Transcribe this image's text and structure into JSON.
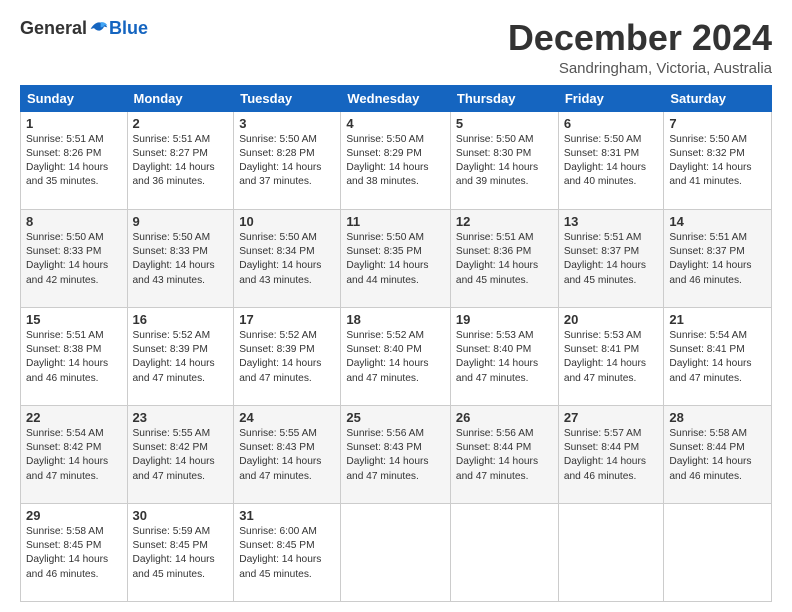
{
  "header": {
    "logo_general": "General",
    "logo_blue": "Blue",
    "month_title": "December 2024",
    "subtitle": "Sandringham, Victoria, Australia"
  },
  "days_of_week": [
    "Sunday",
    "Monday",
    "Tuesday",
    "Wednesday",
    "Thursday",
    "Friday",
    "Saturday"
  ],
  "weeks": [
    [
      {
        "day": "1",
        "sunrise": "5:51 AM",
        "sunset": "8:26 PM",
        "daylight": "14 hours and 35 minutes."
      },
      {
        "day": "2",
        "sunrise": "5:51 AM",
        "sunset": "8:27 PM",
        "daylight": "14 hours and 36 minutes."
      },
      {
        "day": "3",
        "sunrise": "5:50 AM",
        "sunset": "8:28 PM",
        "daylight": "14 hours and 37 minutes."
      },
      {
        "day": "4",
        "sunrise": "5:50 AM",
        "sunset": "8:29 PM",
        "daylight": "14 hours and 38 minutes."
      },
      {
        "day": "5",
        "sunrise": "5:50 AM",
        "sunset": "8:30 PM",
        "daylight": "14 hours and 39 minutes."
      },
      {
        "day": "6",
        "sunrise": "5:50 AM",
        "sunset": "8:31 PM",
        "daylight": "14 hours and 40 minutes."
      },
      {
        "day": "7",
        "sunrise": "5:50 AM",
        "sunset": "8:32 PM",
        "daylight": "14 hours and 41 minutes."
      }
    ],
    [
      {
        "day": "8",
        "sunrise": "5:50 AM",
        "sunset": "8:33 PM",
        "daylight": "14 hours and 42 minutes."
      },
      {
        "day": "9",
        "sunrise": "5:50 AM",
        "sunset": "8:33 PM",
        "daylight": "14 hours and 43 minutes."
      },
      {
        "day": "10",
        "sunrise": "5:50 AM",
        "sunset": "8:34 PM",
        "daylight": "14 hours and 43 minutes."
      },
      {
        "day": "11",
        "sunrise": "5:50 AM",
        "sunset": "8:35 PM",
        "daylight": "14 hours and 44 minutes."
      },
      {
        "day": "12",
        "sunrise": "5:51 AM",
        "sunset": "8:36 PM",
        "daylight": "14 hours and 45 minutes."
      },
      {
        "day": "13",
        "sunrise": "5:51 AM",
        "sunset": "8:37 PM",
        "daylight": "14 hours and 45 minutes."
      },
      {
        "day": "14",
        "sunrise": "5:51 AM",
        "sunset": "8:37 PM",
        "daylight": "14 hours and 46 minutes."
      }
    ],
    [
      {
        "day": "15",
        "sunrise": "5:51 AM",
        "sunset": "8:38 PM",
        "daylight": "14 hours and 46 minutes."
      },
      {
        "day": "16",
        "sunrise": "5:52 AM",
        "sunset": "8:39 PM",
        "daylight": "14 hours and 47 minutes."
      },
      {
        "day": "17",
        "sunrise": "5:52 AM",
        "sunset": "8:39 PM",
        "daylight": "14 hours and 47 minutes."
      },
      {
        "day": "18",
        "sunrise": "5:52 AM",
        "sunset": "8:40 PM",
        "daylight": "14 hours and 47 minutes."
      },
      {
        "day": "19",
        "sunrise": "5:53 AM",
        "sunset": "8:40 PM",
        "daylight": "14 hours and 47 minutes."
      },
      {
        "day": "20",
        "sunrise": "5:53 AM",
        "sunset": "8:41 PM",
        "daylight": "14 hours and 47 minutes."
      },
      {
        "day": "21",
        "sunrise": "5:54 AM",
        "sunset": "8:41 PM",
        "daylight": "14 hours and 47 minutes."
      }
    ],
    [
      {
        "day": "22",
        "sunrise": "5:54 AM",
        "sunset": "8:42 PM",
        "daylight": "14 hours and 47 minutes."
      },
      {
        "day": "23",
        "sunrise": "5:55 AM",
        "sunset": "8:42 PM",
        "daylight": "14 hours and 47 minutes."
      },
      {
        "day": "24",
        "sunrise": "5:55 AM",
        "sunset": "8:43 PM",
        "daylight": "14 hours and 47 minutes."
      },
      {
        "day": "25",
        "sunrise": "5:56 AM",
        "sunset": "8:43 PM",
        "daylight": "14 hours and 47 minutes."
      },
      {
        "day": "26",
        "sunrise": "5:56 AM",
        "sunset": "8:44 PM",
        "daylight": "14 hours and 47 minutes."
      },
      {
        "day": "27",
        "sunrise": "5:57 AM",
        "sunset": "8:44 PM",
        "daylight": "14 hours and 46 minutes."
      },
      {
        "day": "28",
        "sunrise": "5:58 AM",
        "sunset": "8:44 PM",
        "daylight": "14 hours and 46 minutes."
      }
    ],
    [
      {
        "day": "29",
        "sunrise": "5:58 AM",
        "sunset": "8:45 PM",
        "daylight": "14 hours and 46 minutes."
      },
      {
        "day": "30",
        "sunrise": "5:59 AM",
        "sunset": "8:45 PM",
        "daylight": "14 hours and 45 minutes."
      },
      {
        "day": "31",
        "sunrise": "6:00 AM",
        "sunset": "8:45 PM",
        "daylight": "14 hours and 45 minutes."
      },
      null,
      null,
      null,
      null
    ]
  ]
}
